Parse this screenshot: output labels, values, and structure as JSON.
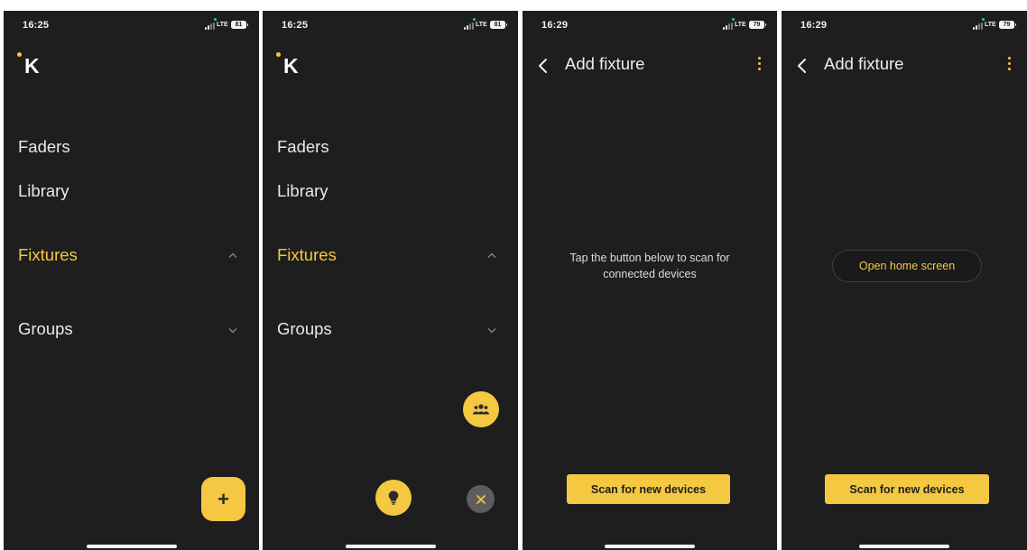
{
  "colors": {
    "accent": "#f5c842",
    "background": "#1e1e1e",
    "text": "#e9e9e9",
    "muted": "#8a8a8a",
    "close_fab": "#5d5d5d",
    "signal_dot": "#46c758"
  },
  "screens": [
    {
      "status": {
        "time": "16:25",
        "network": "LTE",
        "battery": "81"
      },
      "logo": {
        "letter": "K"
      },
      "menu": {
        "items": [
          {
            "label": "Faders",
            "active": false
          },
          {
            "label": "Library",
            "active": false
          },
          {
            "label": "Fixtures",
            "active": true,
            "chevron": "chevron-up-icon"
          },
          {
            "label": "Groups",
            "active": false,
            "chevron": "chevron-down-icon"
          }
        ]
      },
      "fab": {
        "label": "+",
        "icon": "plus-icon"
      }
    },
    {
      "status": {
        "time": "16:25",
        "network": "LTE",
        "battery": "81"
      },
      "logo": {
        "letter": "K"
      },
      "menu": {
        "items": [
          {
            "label": "Faders",
            "active": false
          },
          {
            "label": "Library",
            "active": false
          },
          {
            "label": "Fixtures",
            "active": true,
            "chevron": "chevron-up-icon"
          },
          {
            "label": "Groups",
            "active": false,
            "chevron": "chevron-down-icon"
          }
        ]
      },
      "fab_menu": {
        "group_icon": "group-icon",
        "fixture_icon": "lightbulb-icon",
        "close_icon": "close-icon"
      }
    },
    {
      "status": {
        "time": "16:29",
        "network": "LTE",
        "battery": "79"
      },
      "topbar": {
        "title": "Add fixture",
        "back_icon": "back-arrow-icon",
        "more_icon": "more-vert-icon"
      },
      "hint": {
        "line1": "Tap the button below to scan for",
        "line2": "connected devices"
      },
      "scan_button": "Scan for new devices"
    },
    {
      "status": {
        "time": "16:29",
        "network": "LTE",
        "battery": "79"
      },
      "topbar": {
        "title": "Add fixture",
        "back_icon": "back-arrow-icon",
        "more_icon": "more-vert-icon"
      },
      "open_home_button": "Open home screen",
      "scan_button": "Scan for new devices"
    }
  ]
}
